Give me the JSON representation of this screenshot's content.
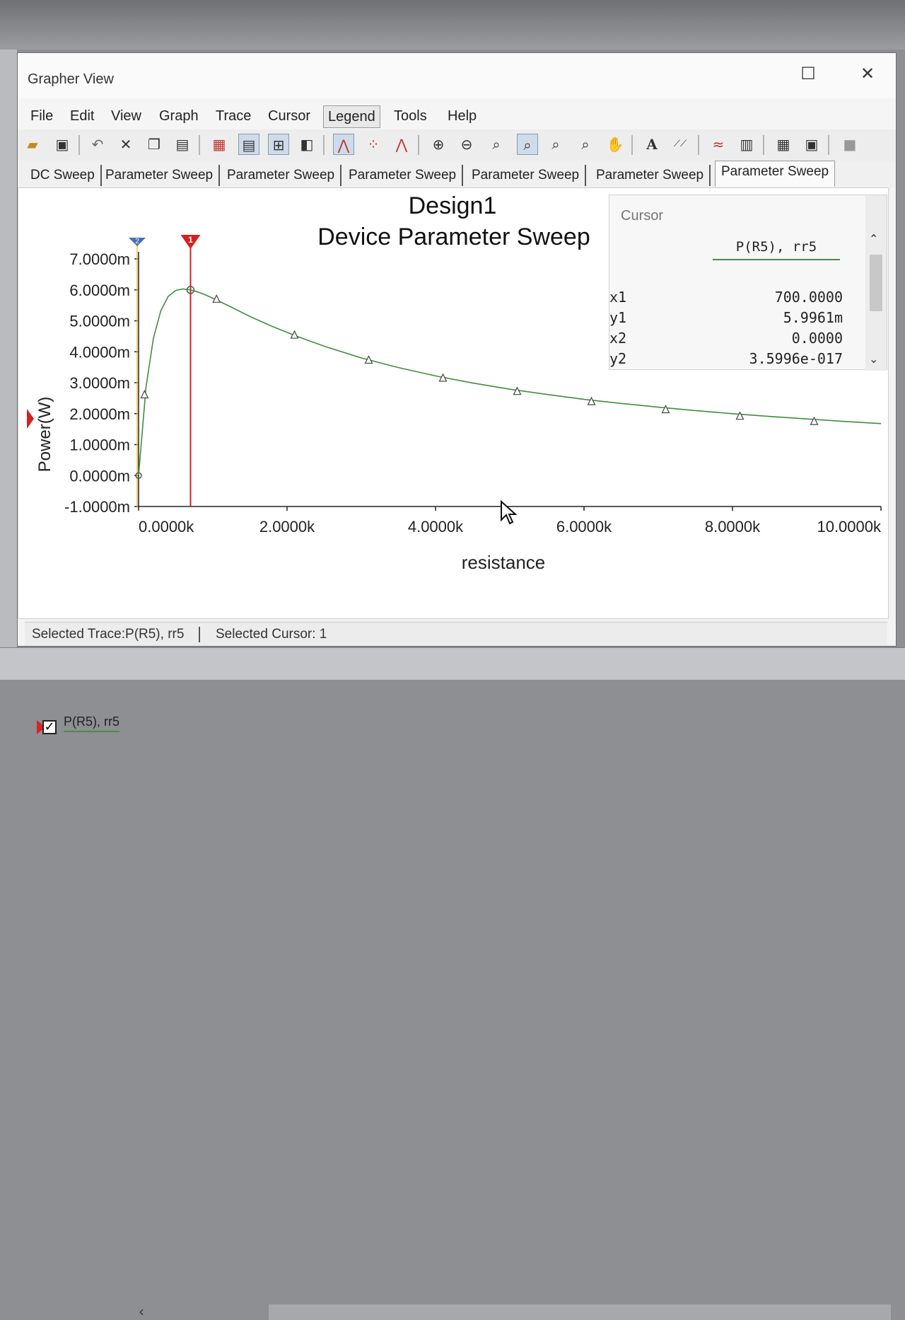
{
  "window": {
    "title": "Grapher View",
    "maximize_glyph": "☐",
    "close_glyph": "✕"
  },
  "menu": [
    "File",
    "Edit",
    "View",
    "Graph",
    "Trace",
    "Cursor",
    "Legend",
    "Tools",
    "Help"
  ],
  "menu_active": "Legend",
  "toolbar_icons": [
    "open-icon",
    "save-icon",
    "undo-icon",
    "delete-icon",
    "copy-icon",
    "paste-icon",
    "grid-icon",
    "legend-toggle-icon",
    "cursor-toggle-icon",
    "overlay-icon",
    "trace-line-icon",
    "trace-points-icon",
    "trace-line-points-icon",
    "zoom-in-icon",
    "zoom-out-icon",
    "zoom-area-icon",
    "zoom-fit-icon",
    "zoom-x-icon",
    "zoom-y-icon",
    "pan-hand-icon",
    "text-icon",
    "label-icon",
    "compare-icon",
    "export-icon",
    "export-table-icon",
    "export-graph-icon",
    "stop-icon"
  ],
  "tabs": [
    "DC Sweep",
    "Parameter Sweep",
    "Parameter Sweep",
    "Parameter Sweep",
    "Parameter Sweep",
    "Parameter Sweep",
    "Parameter Sweep"
  ],
  "active_tab_index": 6,
  "cursor_panel": {
    "title": "Cursor",
    "column_header": "P(R5), rr5",
    "rows": [
      {
        "label": "x1",
        "value": "700.0000"
      },
      {
        "label": "y1",
        "value": "5.9961m"
      },
      {
        "label": "x2",
        "value": "0.0000"
      },
      {
        "label": "y2",
        "value": "3.5996e-017"
      }
    ],
    "scroll_up": "⌃",
    "scroll_down": "⌄"
  },
  "legend": {
    "label": "P(R5), rr5",
    "check": "✓"
  },
  "status": {
    "trace": "Selected Trace:P(R5), rr5",
    "cursor": "Selected Cursor: 1"
  },
  "cursor_markers": {
    "cursor1_label": "1",
    "cursor2_label": "2"
  },
  "colors": {
    "trace": "#3f8f3f",
    "cursor1": "#d42020",
    "cursor2": "#f0c040"
  },
  "chart_data": {
    "type": "line",
    "title": "Design1",
    "subtitle": "Device Parameter Sweep",
    "xlabel": "resistance",
    "ylabel": "Power(W)",
    "xlim": [
      0,
      10000
    ],
    "ylim": [
      -1.0,
      7.0
    ],
    "x_ticks": [
      0,
      2000,
      4000,
      6000,
      8000,
      10000
    ],
    "x_tick_labels": [
      "0.0000k",
      "2.0000k",
      "4.0000k",
      "6.0000k",
      "8.0000k",
      "10.0000k"
    ],
    "y_ticks": [
      -1,
      0,
      1,
      2,
      3,
      4,
      5,
      6,
      7
    ],
    "y_tick_labels": [
      "-1.0000m",
      "0.0000m",
      "1.0000m",
      "2.0000m",
      "3.0000m",
      "4.0000m",
      "5.0000m",
      "6.0000m",
      "7.0000m"
    ],
    "y_unit_scale": "m",
    "grid": false,
    "series": [
      {
        "name": "P(R5), rr5",
        "x": [
          0,
          100,
          200,
          300,
          400,
          500,
          600,
          700,
          800,
          900,
          1000,
          1200,
          1500,
          1800,
          2100,
          2500,
          3000,
          3500,
          4000,
          4500,
          5000,
          5500,
          6000,
          6500,
          7000,
          7500,
          8000,
          8500,
          9000,
          9500,
          10000
        ],
        "y": [
          0.0,
          2.86,
          4.44,
          5.33,
          5.79,
          5.98,
          6.03,
          6.0,
          5.93,
          5.84,
          5.73,
          5.5,
          5.14,
          4.82,
          4.53,
          4.18,
          3.8,
          3.49,
          3.22,
          2.99,
          2.79,
          2.62,
          2.46,
          2.33,
          2.21,
          2.1,
          2.0,
          1.91,
          1.83,
          1.75,
          1.68
        ]
      }
    ],
    "markers": {
      "x": [
        80,
        1050,
        2100,
        3100,
        4100,
        5100,
        6100,
        7100,
        8100,
        9100
      ],
      "y": [
        2.6,
        5.69,
        4.53,
        3.72,
        3.14,
        2.71,
        2.38,
        2.12,
        1.91,
        1.74
      ]
    },
    "cursors": {
      "x1": 700,
      "y1": 5.9961,
      "x2": 0,
      "y2": 3.5996e-17
    }
  }
}
